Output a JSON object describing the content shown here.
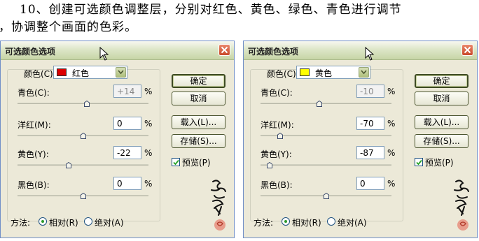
{
  "caption": {
    "line1": "10、创建可选颜色调整层，分别对红色、黄色、绿色、青色进行调节",
    "line2": "，协调整个画面的色彩。"
  },
  "dialogs": [
    {
      "title": "可选颜色选项",
      "color_label": "颜色(C):",
      "color_value": "红色",
      "swatch": "#dd0000",
      "sliders": [
        {
          "label": "青色(C):",
          "value": "+14",
          "selected": true,
          "level": 0.53
        },
        {
          "label": "洋红(M):",
          "value": "0",
          "selected": false,
          "level": 0.5
        },
        {
          "label": "黄色(Y):",
          "value": "-22",
          "selected": false,
          "level": 0.39
        },
        {
          "label": "黑色(B):",
          "value": "0",
          "selected": false,
          "level": 0.5
        }
      ],
      "percent": "%",
      "buttons": {
        "ok": "确定",
        "cancel": "取消",
        "load": "载入(L)...",
        "save": "存储(S)..."
      },
      "preview_label": "预览(P)",
      "preview_checked": true,
      "method_label": "方法:",
      "relative_label": "相对(R)",
      "absolute_label": "绝对(A)"
    },
    {
      "title": "可选颜色选项",
      "color_label": "颜色(C):",
      "color_value": "黄色",
      "swatch": "#ffff00",
      "sliders": [
        {
          "label": "青色(C):",
          "value": "-10",
          "selected": true,
          "level": 0.45
        },
        {
          "label": "洋红(M):",
          "value": "-70",
          "selected": false,
          "level": 0.15
        },
        {
          "label": "黄色(Y):",
          "value": "-87",
          "selected": false,
          "level": 0.07
        },
        {
          "label": "黑色(B):",
          "value": "0",
          "selected": false,
          "level": 0.5
        }
      ],
      "percent": "%",
      "buttons": {
        "ok": "确定",
        "cancel": "取消",
        "load": "载入(L)...",
        "save": "存储(S)..."
      },
      "preview_label": "预览(P)",
      "preview_checked": true,
      "method_label": "方法:",
      "relative_label": "相对(R)",
      "absolute_label": "绝对(A)"
    }
  ]
}
